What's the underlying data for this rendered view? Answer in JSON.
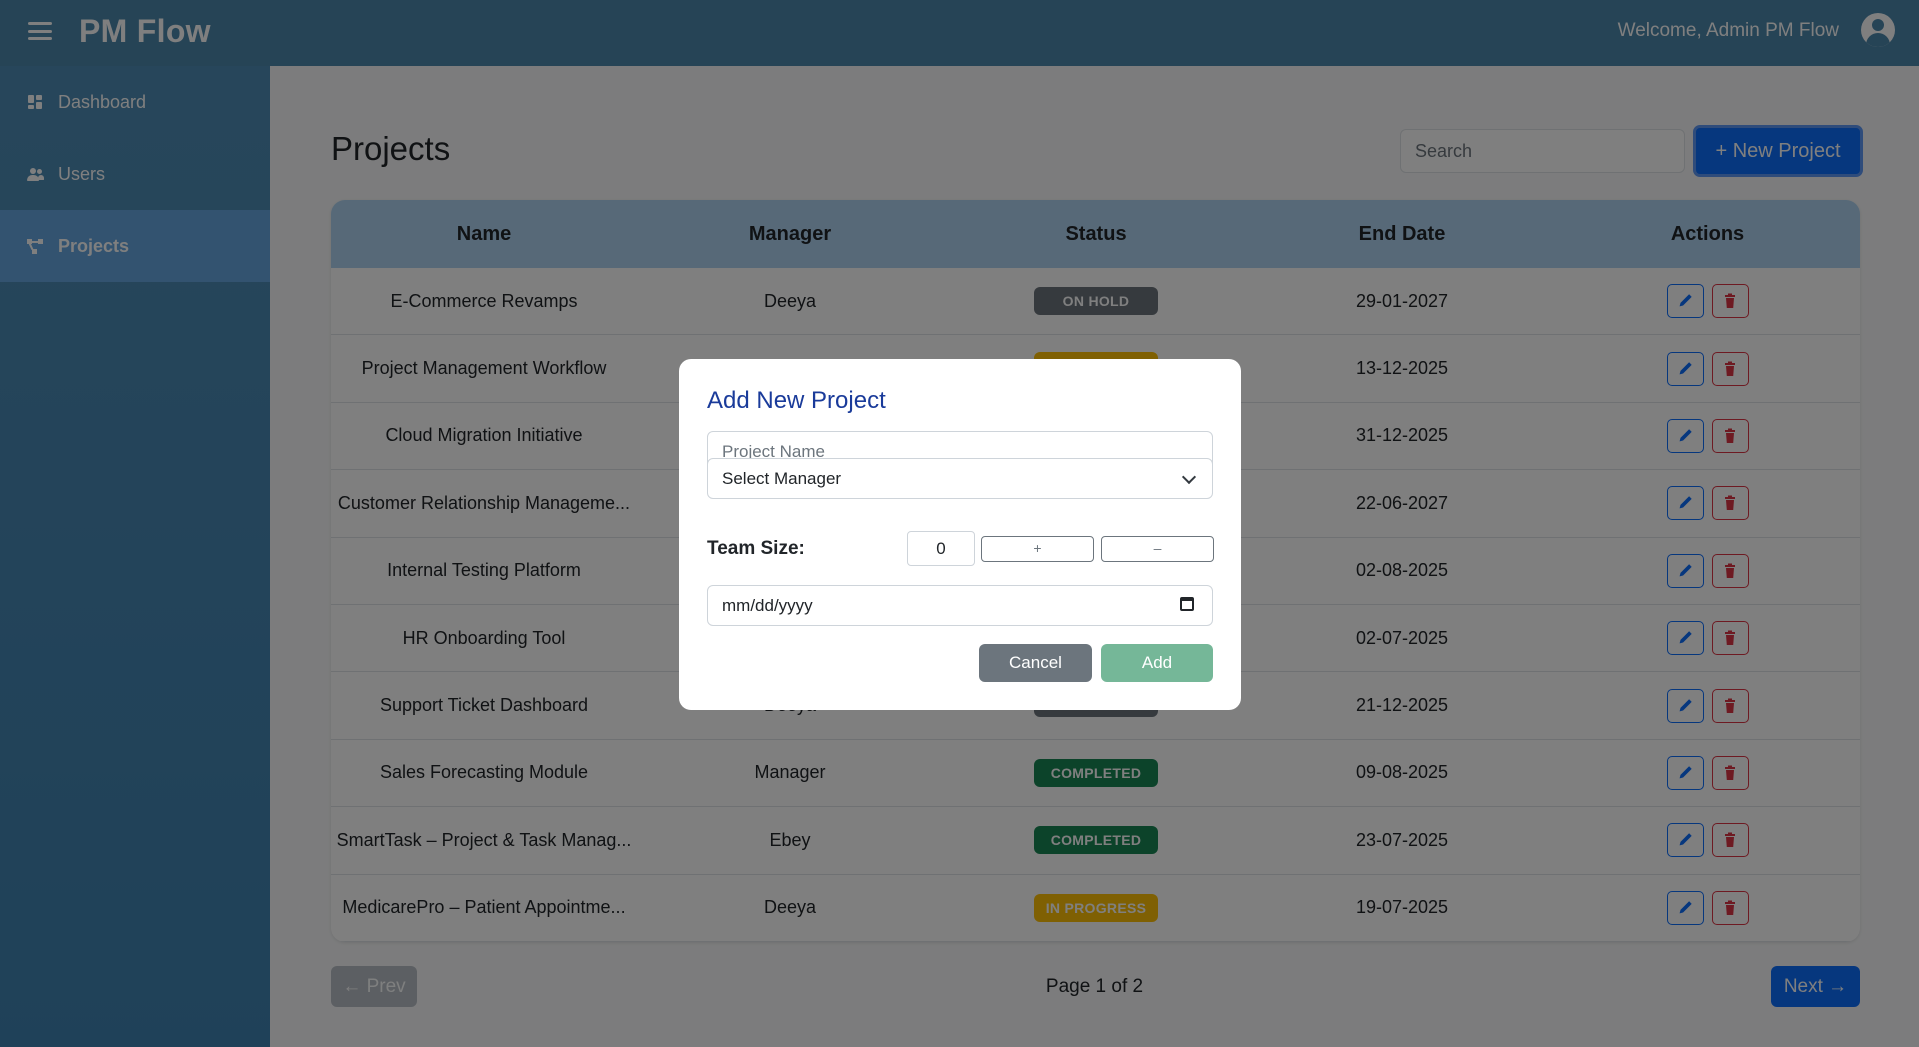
{
  "app": {
    "title": "PM Flow",
    "welcome": "Welcome, Admin PM Flow"
  },
  "sidebar": {
    "items": [
      {
        "label": "Dashboard",
        "icon": "dashboard-icon"
      },
      {
        "label": "Users",
        "icon": "users-icon"
      },
      {
        "label": "Projects",
        "icon": "projects-icon",
        "active": true
      }
    ]
  },
  "main": {
    "title": "Projects",
    "search_placeholder": "Search",
    "new_button": "+ New Project"
  },
  "table": {
    "headers": [
      "Name",
      "Manager",
      "Status",
      "End Date",
      "Actions"
    ],
    "rows": [
      {
        "name": "E-Commerce Revamps",
        "manager": "Deeya",
        "status": "ON HOLD",
        "status_color": "#6c757d",
        "end_date": "29-01-2027"
      },
      {
        "name": "Project Management Workflow",
        "manager": "",
        "status": "",
        "status_color": "#ffc107",
        "end_date": "13-12-2025"
      },
      {
        "name": "Cloud Migration Initiative",
        "manager": "",
        "status": "",
        "status_color": "",
        "end_date": "31-12-2025"
      },
      {
        "name": "Customer Relationship Manageme...",
        "manager": "",
        "status": "",
        "status_color": "",
        "end_date": "22-06-2027"
      },
      {
        "name": "Internal Testing Platform",
        "manager": "",
        "status": "",
        "status_color": "",
        "end_date": "02-08-2025"
      },
      {
        "name": "HR Onboarding Tool",
        "manager": "",
        "status": "",
        "status_color": "",
        "end_date": "02-07-2025"
      },
      {
        "name": "Support Ticket Dashboard",
        "manager": "Deeya",
        "status": "",
        "status_color": "#6c757d",
        "end_date": "21-12-2025"
      },
      {
        "name": "Sales Forecasting Module",
        "manager": "Manager",
        "status": "COMPLETED",
        "status_color": "#198754",
        "end_date": "09-08-2025"
      },
      {
        "name": "SmartTask – Project & Task Manag...",
        "manager": "Ebey",
        "status": "COMPLETED",
        "status_color": "#198754",
        "end_date": "23-07-2025"
      },
      {
        "name": "MedicarePro – Patient Appointme...",
        "manager": "Deeya",
        "status": "IN PROGRESS",
        "status_color": "#ffc107",
        "end_date": "19-07-2025"
      }
    ]
  },
  "pagination": {
    "prev": "← Prev",
    "info": "Page 1 of 2",
    "next": "Next →"
  },
  "modal": {
    "title": "Add New Project",
    "project_name_placeholder": "Project Name",
    "manager_select": "Select Manager",
    "team_size_label": "Team Size:",
    "team_size_value": "0",
    "increment_label": "+",
    "decrement_label": "–",
    "date_placeholder": "mm/dd/yyyy",
    "cancel": "Cancel",
    "add": "Add"
  },
  "colors": {
    "topbar": "#4d88ad",
    "primary": "#0d6efd",
    "danger": "#dc3545",
    "success": "#198754",
    "warning": "#ffc107",
    "secondary": "#6c757d"
  }
}
